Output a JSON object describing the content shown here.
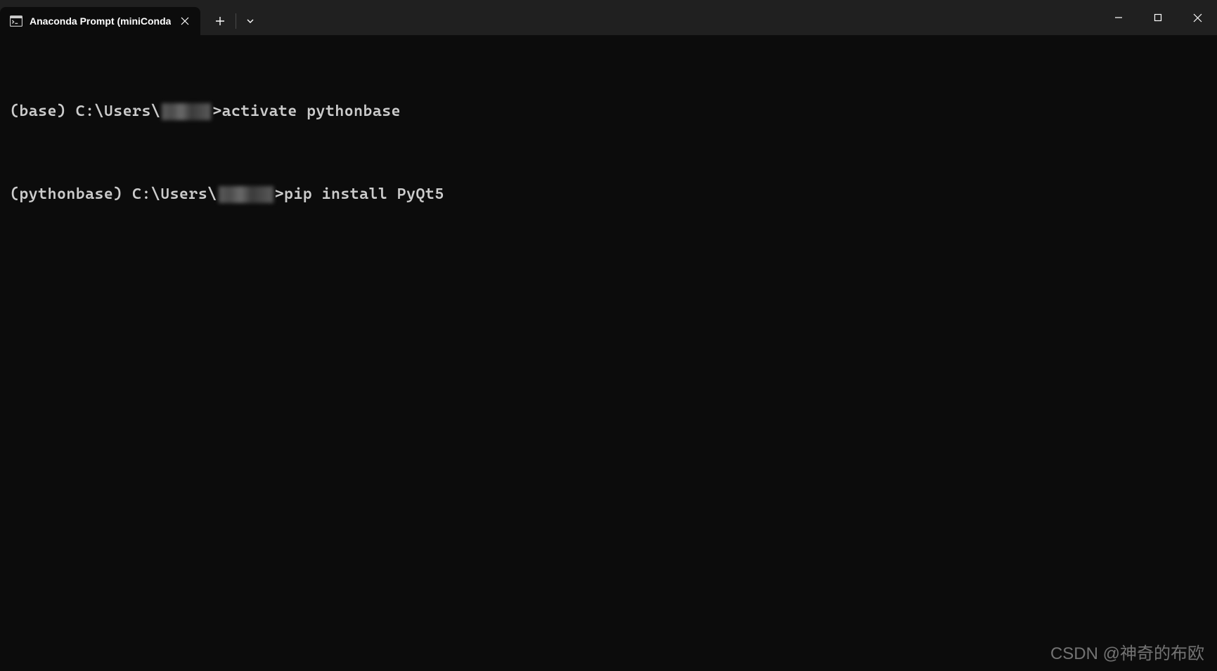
{
  "titlebar": {
    "tab": {
      "title": "Anaconda Prompt (miniConda"
    }
  },
  "terminal": {
    "line1": {
      "prefix": "(base) C:\\Users\\",
      "suffix": ">activate pythonbase"
    },
    "line2": {
      "prefix": "(pythonbase) C:\\Users\\",
      "suffix": ">pip install PyQt5"
    }
  },
  "watermark": "CSDN @神奇的布欧"
}
